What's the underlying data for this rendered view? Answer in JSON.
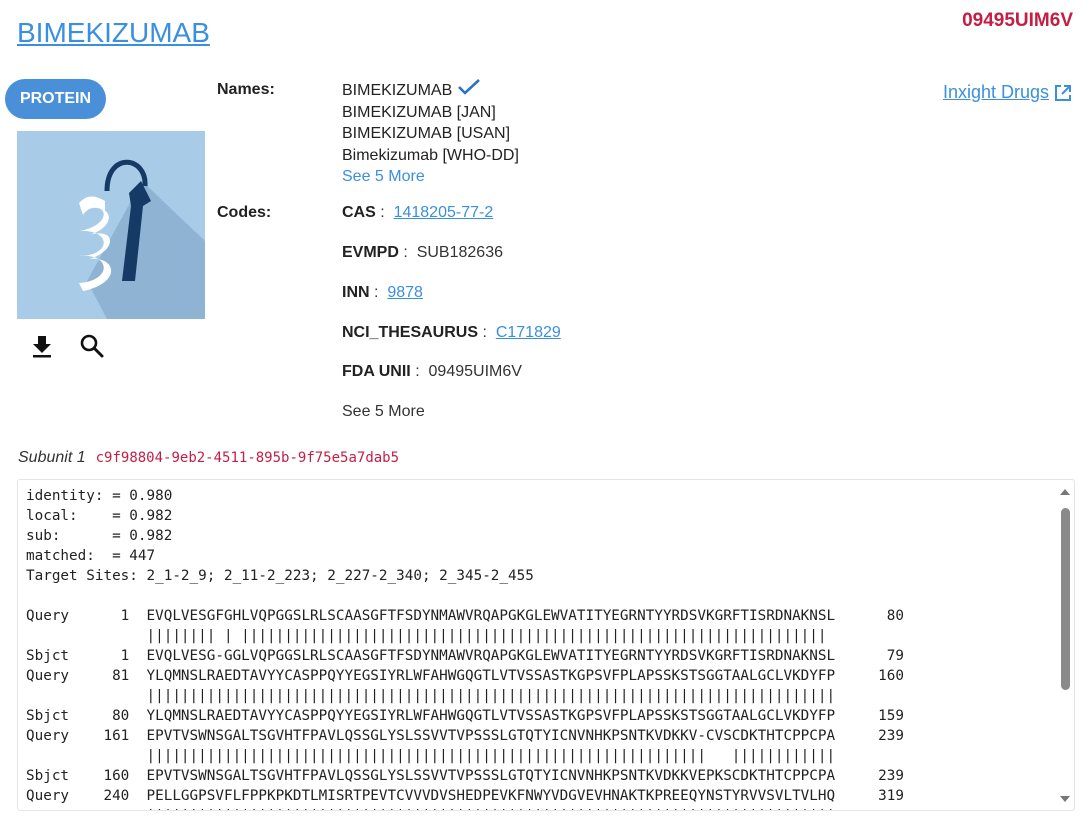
{
  "header": {
    "title": "BIMEKIZUMAB",
    "unii_badge": "09495UIM6V"
  },
  "substance_type": "PROTEIN",
  "icons": {
    "download": "download-icon",
    "search": "search-icon",
    "verified": "checkmark-icon",
    "external": "external-link-icon"
  },
  "names_section": {
    "label": "Names:",
    "items": [
      "BIMEKIZUMAB",
      "BIMEKIZUMAB [JAN]",
      "BIMEKIZUMAB [USAN]",
      "Bimekizumab [WHO-DD]"
    ],
    "see_more": "See 5 More"
  },
  "codes_section": {
    "label": "Codes:",
    "items": [
      {
        "system": "CAS",
        "sep": ":",
        "value": "1418205-77-2",
        "is_link": true
      },
      {
        "system": "EVMPD",
        "sep": ":",
        "value": "SUB182636",
        "is_link": false
      },
      {
        "system": "INN",
        "sep": ":",
        "value": "9878",
        "is_link": true
      },
      {
        "system": "NCI_THESAURUS",
        "sep": ":",
        "value": "C171829",
        "is_link": true
      },
      {
        "system": "FDA UNII",
        "sep": ":",
        "value": "09495UIM6V",
        "is_link": false
      }
    ],
    "see_more": "See 5 More"
  },
  "inxight_link": "Inxight Drugs",
  "subunit": {
    "label": "Subunit 1",
    "id": "c9f98804-9eb2-4511-895b-9f75e5a7dab5"
  },
  "alignment_text": "identity: = 0.980\nlocal:    = 0.982\nsub:      = 0.982\nmatched:  = 447\nTarget Sites: 2_1-2_9; 2_11-2_223; 2_227-2_340; 2_345-2_455\n\nQuery      1  EVQLVESGFGHLVQPGGSLRLSCAASGFTFSDYNMAWVRQAPGKGLEWVATITYEGRNTYYRDSVKGRFTISRDNAKNSL      80\n              |||||||| | ||||||||||||||||||||||||||||||||||||||||||||||||||||||||||||||||||||\nSbjct      1  EVQLVESG-GGLVQPGGSLRLSCAASGFTFSDYNMAWVRQAPGKGLEWVATITYEGRNTYYRDSVKGRFTISRDNAKNSL      79\nQuery     81  YLQMNSLRAEDTAVYYCASPPQYYEGSIYRLWFAHWGQGTLVTVSSASTKGPSVFPLAPSSKSTSGGTAALGCLVKDYFP     160\n              ||||||||||||||||||||||||||||||||||||||||||||||||||||||||||||||||||||||||||||||||\nSbjct     80  YLQMNSLRAEDTAVYYCASPPQYYEGSIYRLWFAHWGQGTLVTVSSASTKGPSVFPLAPSSKSTSGGTAALGCLVKDYFP     159\nQuery    161  EPVTVSWNSGALTSGVHTFPAVLQSSGLYSLSSVVTVPSSSLGTQTYICNVNHKPSNTKVDKKV-CVSCDKTHTCPPCPA     239\n              |||||||||||||||||||||||||||||||||||||||||||||||||||||||||||||||||   ||||||||||||\nSbjct    160  EPVTVSWNSGALTSGVHTFPAVLQSSGLYSLSSVVTVPSSSLGTQTYICNVNHKPSNTKVDKKVEPKSCDKTHTCPPCPA     239\nQuery    240  PELLGGPSVFLFPPKPKDTLMISRTPEVTCVVVDVSHEDPEVKFNWYVDGVEVHNAKTKPREEQYNSTYRVVSVLTVLHQ     319\n              ||||||||||||||||||||||||||||||||||||||||||||||||||||||||||||||||||||||||||||||||"
}
